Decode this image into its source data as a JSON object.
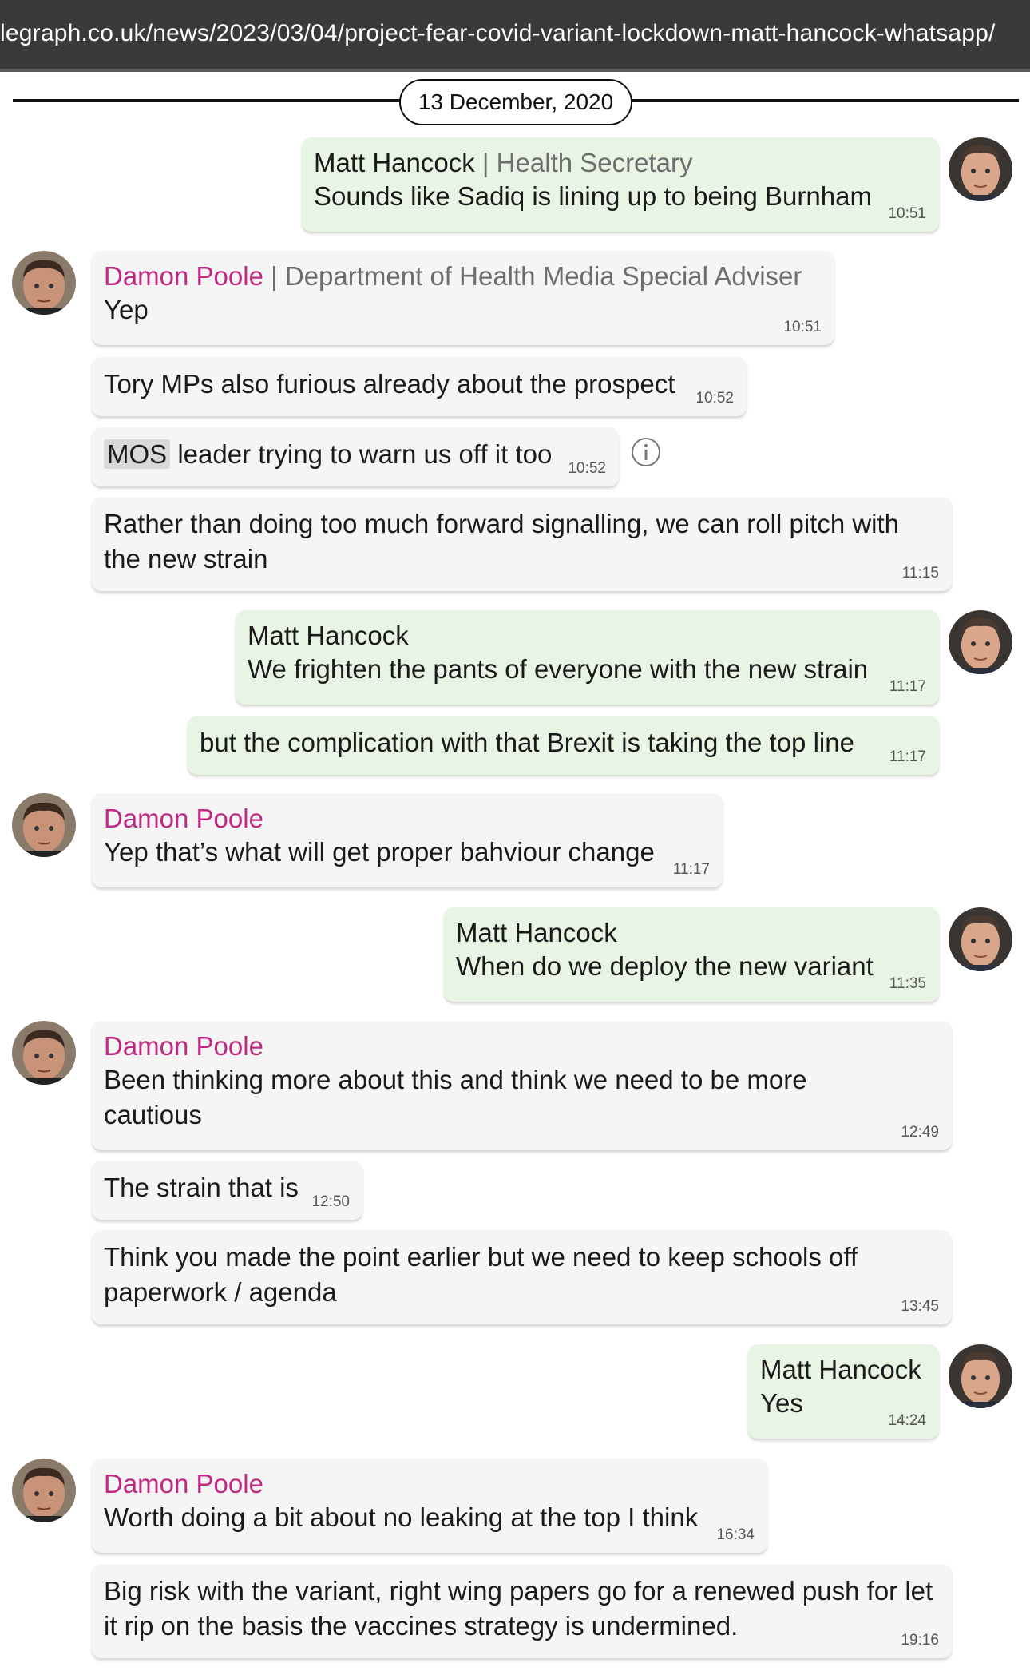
{
  "browser": {
    "url": "legraph.co.uk/news/2023/03/04/project-fear-covid-variant-lockdown-matt-hancock-whatsapp/"
  },
  "date": "13 December, 2020",
  "colors": {
    "sender_in": "#c02883",
    "bubble_in": "#f5f5f5",
    "bubble_out": "#e8f5e4"
  },
  "messages": [
    {
      "sender": "Matt Hancock",
      "role": "Health Secretary",
      "text": "Sounds like Sadiq is lining up to being Burnham",
      "time": "10:51"
    },
    {
      "sender": "Damon Poole",
      "role": "Department of Health Media Special Adviser",
      "text": "Yep",
      "time": "10:51"
    },
    {
      "text": "Tory MPs also furious already about the prospect",
      "time": "10:52"
    },
    {
      "tag": "MOS",
      "text": "leader trying to warn us off it too",
      "time": "10:52",
      "icon": "info-icon"
    },
    {
      "text": "Rather than doing too much forward signalling, we can roll pitch with the new strain",
      "time": "11:15"
    },
    {
      "sender": "Matt Hancock",
      "text": "We frighten the pants of everyone with the new strain",
      "time": "11:17"
    },
    {
      "text": "but the complication with that Brexit is taking the top line",
      "time": "11:17"
    },
    {
      "sender": "Damon Poole",
      "text": "Yep that’s what will get proper bahviour change",
      "time": "11:17"
    },
    {
      "sender": "Matt Hancock",
      "text": "When do we deploy the new variant",
      "time": "11:35"
    },
    {
      "sender": "Damon Poole",
      "text": "Been thinking more about this and think we need to be more cautious",
      "time": "12:49"
    },
    {
      "text": "The strain that is",
      "time": "12:50"
    },
    {
      "text": "Think you made the point earlier but we need to keep schools off paperwork / agenda",
      "time": "13:45"
    },
    {
      "sender": "Matt Hancock",
      "text": "Yes",
      "time": "14:24"
    },
    {
      "sender": "Damon Poole",
      "text": "Worth doing a bit about no leaking at the top I think",
      "time": "16:34"
    },
    {
      "text": "Big risk with the variant, right wing papers go for a renewed push for let it rip on the basis the vaccines strategy is undermined.",
      "time": "19:16"
    }
  ]
}
